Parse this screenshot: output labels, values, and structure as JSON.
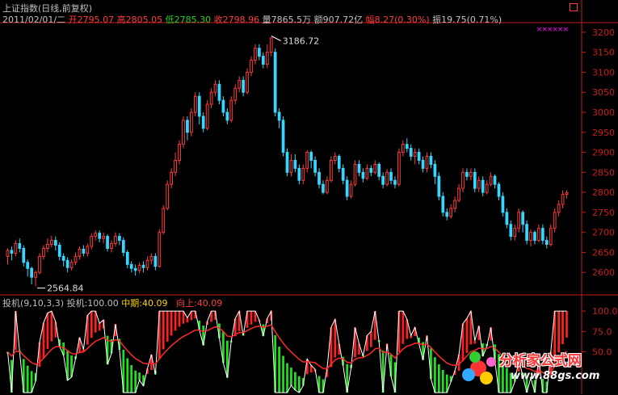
{
  "header": {
    "title": "上证指数(日线,前复权)",
    "date_label": "2011/02/01/二",
    "open_label": "开",
    "open": "2795.07",
    "high_label": "高",
    "high": "2805.05",
    "low_label": "低",
    "low": "2785.30",
    "close_label": "收",
    "close": "2798.96",
    "volume_label": "量",
    "volume": "7865.5万",
    "amount_label": "额",
    "amount": "907.72亿",
    "change_label": "幅",
    "change": "8.27(0.30%)",
    "amplitude_label": "振",
    "amplitude": "19.75(0.71%)"
  },
  "indicator": {
    "name": "投机(9,10,3,3)",
    "line1_label": "投机:",
    "line1_value": "100.00",
    "line2_label": "中期:",
    "line2_value": "40.09",
    "line3_label": "向上:",
    "line3_value": "40.09"
  },
  "annotations": {
    "max_label": "3186.72",
    "min_label": "2564.84",
    "marker": "××××××"
  },
  "watermark": {
    "title": "分析家公式网",
    "url": "www.88gs.com"
  },
  "colors": {
    "up": "#ff3b3b",
    "down": "#36d6ff",
    "axis": "#c81e1e",
    "ind_up": "#ff2020",
    "ind_down": "#21e021",
    "ind_white": "#ffffff",
    "ind_mid": "#ff2a2a",
    "ind_yellow": "#ffee44"
  },
  "chart_data": {
    "type": "candlestick",
    "y_axis_main": {
      "range": [
        2550,
        3220
      ],
      "ticks": [
        2600,
        2650,
        2700,
        2750,
        2800,
        2850,
        2900,
        2950,
        3000,
        3050,
        3100,
        3150,
        3200
      ]
    },
    "y_axis_indicator": {
      "range": [
        0,
        110
      ],
      "ticks": [
        100.0,
        75.0,
        50.0
      ]
    },
    "max_value": 3186.72,
    "min_value": 2564.84,
    "candles": [
      [
        2640,
        2655,
        2620,
        2660
      ],
      [
        2655,
        2648,
        2630,
        2665
      ],
      [
        2648,
        2672,
        2640,
        2680
      ],
      [
        2672,
        2660,
        2650,
        2685
      ],
      [
        2660,
        2625,
        2615,
        2668
      ],
      [
        2625,
        2610,
        2590,
        2632
      ],
      [
        2610,
        2588,
        2570,
        2615
      ],
      [
        2588,
        2600,
        2565,
        2605
      ],
      [
        2600,
        2640,
        2595,
        2648
      ],
      [
        2640,
        2660,
        2632,
        2668
      ],
      [
        2660,
        2670,
        2650,
        2685
      ],
      [
        2670,
        2680,
        2662,
        2692
      ],
      [
        2680,
        2668,
        2655,
        2690
      ],
      [
        2668,
        2640,
        2630,
        2675
      ],
      [
        2640,
        2630,
        2615,
        2648
      ],
      [
        2630,
        2612,
        2600,
        2638
      ],
      [
        2612,
        2625,
        2605,
        2632
      ],
      [
        2625,
        2640,
        2618,
        2650
      ],
      [
        2640,
        2658,
        2632,
        2665
      ],
      [
        2658,
        2648,
        2640,
        2668
      ],
      [
        2648,
        2665,
        2640,
        2672
      ],
      [
        2665,
        2690,
        2658,
        2698
      ],
      [
        2690,
        2698,
        2680,
        2705
      ],
      [
        2698,
        2685,
        2675,
        2705
      ],
      [
        2685,
        2690,
        2672,
        2700
      ],
      [
        2690,
        2660,
        2652,
        2695
      ],
      [
        2660,
        2672,
        2650,
        2680
      ],
      [
        2672,
        2690,
        2664,
        2700
      ],
      [
        2690,
        2680,
        2668,
        2698
      ],
      [
        2680,
        2650,
        2640,
        2688
      ],
      [
        2650,
        2620,
        2610,
        2656
      ],
      [
        2620,
        2610,
        2600,
        2628
      ],
      [
        2610,
        2605,
        2592,
        2620
      ],
      [
        2605,
        2618,
        2598,
        2625
      ],
      [
        2618,
        2612,
        2600,
        2628
      ],
      [
        2612,
        2630,
        2605,
        2640
      ],
      [
        2630,
        2640,
        2620,
        2648
      ],
      [
        2640,
        2615,
        2605,
        2648
      ],
      [
        2615,
        2700,
        2612,
        2708
      ],
      [
        2700,
        2760,
        2695,
        2768
      ],
      [
        2760,
        2820,
        2755,
        2830
      ],
      [
        2820,
        2850,
        2810,
        2860
      ],
      [
        2850,
        2880,
        2840,
        2900
      ],
      [
        2880,
        2920,
        2870,
        2930
      ],
      [
        2920,
        2980,
        2910,
        2990
      ],
      [
        2980,
        2950,
        2930,
        2990
      ],
      [
        2950,
        3000,
        2940,
        3010
      ],
      [
        3000,
        3040,
        2990,
        3050
      ],
      [
        3040,
        2990,
        2970,
        3050
      ],
      [
        2990,
        2960,
        2950,
        3000
      ],
      [
        2960,
        3020,
        2955,
        3030
      ],
      [
        3020,
        3050,
        3010,
        3060
      ],
      [
        3050,
        3070,
        3040,
        3080
      ],
      [
        3070,
        3030,
        3020,
        3080
      ],
      [
        3030,
        3000,
        2990,
        3040
      ],
      [
        3000,
        2980,
        2970,
        3010
      ],
      [
        2980,
        3030,
        2975,
        3040
      ],
      [
        3030,
        3060,
        3020,
        3070
      ],
      [
        3060,
        3080,
        3050,
        3090
      ],
      [
        3080,
        3050,
        3040,
        3090
      ],
      [
        3050,
        3100,
        3045,
        3110
      ],
      [
        3100,
        3130,
        3090,
        3140
      ],
      [
        3130,
        3160,
        3120,
        3170
      ],
      [
        3160,
        3140,
        3130,
        3170
      ],
      [
        3140,
        3120,
        3110,
        3150
      ],
      [
        3120,
        3150,
        3110,
        3170
      ],
      [
        3150,
        3186,
        3140,
        3186
      ],
      [
        3150,
        3000,
        2990,
        3160
      ],
      [
        3000,
        2980,
        2960,
        3010
      ],
      [
        2980,
        2900,
        2890,
        2990
      ],
      [
        2900,
        2850,
        2840,
        2910
      ],
      [
        2850,
        2880,
        2840,
        2895
      ],
      [
        2880,
        2860,
        2850,
        2895
      ],
      [
        2860,
        2830,
        2820,
        2870
      ],
      [
        2830,
        2860,
        2820,
        2870
      ],
      [
        2860,
        2900,
        2850,
        2905
      ],
      [
        2900,
        2880,
        2860,
        2905
      ],
      [
        2880,
        2850,
        2840,
        2890
      ],
      [
        2850,
        2820,
        2810,
        2860
      ],
      [
        2820,
        2800,
        2795,
        2830
      ],
      [
        2800,
        2830,
        2795,
        2840
      ],
      [
        2830,
        2880,
        2825,
        2890
      ],
      [
        2880,
        2890,
        2870,
        2900
      ],
      [
        2890,
        2860,
        2850,
        2895
      ],
      [
        2860,
        2830,
        2820,
        2870
      ],
      [
        2830,
        2790,
        2780,
        2840
      ],
      [
        2790,
        2820,
        2785,
        2830
      ],
      [
        2820,
        2870,
        2815,
        2880
      ],
      [
        2870,
        2850,
        2840,
        2880
      ],
      [
        2850,
        2835,
        2825,
        2860
      ],
      [
        2835,
        2860,
        2830,
        2870
      ],
      [
        2860,
        2850,
        2840,
        2868
      ],
      [
        2850,
        2870,
        2845,
        2880
      ],
      [
        2870,
        2840,
        2830,
        2875
      ],
      [
        2840,
        2820,
        2810,
        2850
      ],
      [
        2820,
        2850,
        2815,
        2858
      ],
      [
        2850,
        2830,
        2820,
        2860
      ],
      [
        2830,
        2820,
        2810,
        2840
      ],
      [
        2820,
        2900,
        2815,
        2910
      ],
      [
        2900,
        2920,
        2890,
        2930
      ],
      [
        2920,
        2910,
        2900,
        2935
      ],
      [
        2910,
        2890,
        2880,
        2920
      ],
      [
        2890,
        2900,
        2870,
        2910
      ],
      [
        2900,
        2880,
        2870,
        2910
      ],
      [
        2880,
        2860,
        2850,
        2890
      ],
      [
        2860,
        2890,
        2850,
        2900
      ],
      [
        2890,
        2870,
        2860,
        2900
      ],
      [
        2870,
        2840,
        2820,
        2880
      ],
      [
        2840,
        2790,
        2780,
        2850
      ],
      [
        2790,
        2750,
        2740,
        2800
      ],
      [
        2750,
        2740,
        2730,
        2760
      ],
      [
        2740,
        2760,
        2735,
        2770
      ],
      [
        2760,
        2780,
        2750,
        2790
      ],
      [
        2780,
        2810,
        2775,
        2820
      ],
      [
        2810,
        2850,
        2800,
        2860
      ],
      [
        2850,
        2840,
        2830,
        2860
      ],
      [
        2840,
        2850,
        2830,
        2860
      ],
      [
        2850,
        2810,
        2800,
        2860
      ],
      [
        2810,
        2830,
        2800,
        2840
      ],
      [
        2830,
        2800,
        2790,
        2840
      ],
      [
        2800,
        2820,
        2795,
        2830
      ],
      [
        2820,
        2840,
        2815,
        2850
      ],
      [
        2840,
        2820,
        2810,
        2845
      ],
      [
        2820,
        2790,
        2780,
        2825
      ],
      [
        2790,
        2750,
        2740,
        2800
      ],
      [
        2750,
        2720,
        2710,
        2760
      ],
      [
        2720,
        2690,
        2680,
        2730
      ],
      [
        2690,
        2710,
        2680,
        2720
      ],
      [
        2710,
        2750,
        2700,
        2760
      ],
      [
        2750,
        2720,
        2700,
        2755
      ],
      [
        2720,
        2680,
        2670,
        2730
      ],
      [
        2680,
        2700,
        2665,
        2708
      ],
      [
        2700,
        2680,
        2670,
        2705
      ],
      [
        2680,
        2710,
        2675,
        2720
      ],
      [
        2710,
        2680,
        2670,
        2720
      ],
      [
        2680,
        2670,
        2660,
        2690
      ],
      [
        2670,
        2710,
        2665,
        2720
      ],
      [
        2710,
        2750,
        2700,
        2760
      ],
      [
        2750,
        2770,
        2740,
        2780
      ],
      [
        2770,
        2795,
        2760,
        2805
      ],
      [
        2795,
        2799,
        2785,
        2805
      ]
    ]
  }
}
